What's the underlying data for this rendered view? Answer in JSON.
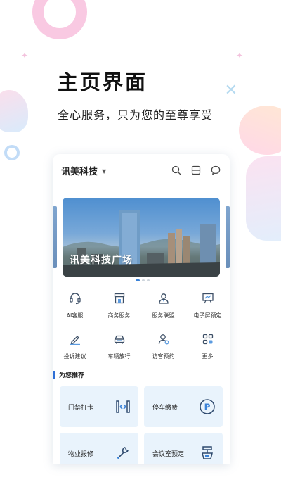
{
  "headline": {
    "title": "主页界面",
    "subtitle": "全心服务，只为您的至尊享受"
  },
  "app": {
    "company_name": "讯美科技",
    "top_icons": [
      "search-icon",
      "scan-icon",
      "message-icon"
    ],
    "banner": {
      "text": "讯美科技广场",
      "slide_count": 3,
      "active_slide": 1
    },
    "services_row1": [
      {
        "label": "AI客服",
        "icon": "headset-icon"
      },
      {
        "label": "商务服务",
        "icon": "store-icon"
      },
      {
        "label": "服务联盟",
        "icon": "person-badge-icon"
      },
      {
        "label": "电子屏预定",
        "icon": "screen-easel-icon"
      }
    ],
    "services_row2": [
      {
        "label": "投诉建议",
        "icon": "pen-edit-icon"
      },
      {
        "label": "车辆放行",
        "icon": "car-icon"
      },
      {
        "label": "访客预约",
        "icon": "visitor-icon"
      },
      {
        "label": "更多",
        "icon": "grid-more-icon"
      }
    ],
    "recommend_title": "为您推荐",
    "tiles": [
      {
        "label": "门禁打卡",
        "icon": "gate-icon"
      },
      {
        "label": "停车缴费",
        "icon": "parking-icon"
      },
      {
        "label": "物业报修",
        "icon": "wrench-icon"
      },
      {
        "label": "会议室预定",
        "icon": "meeting-icon"
      }
    ],
    "colors": {
      "accent": "#2f6fd6",
      "icon_stroke": "#3d4f66",
      "tile_bg": "#e9f3fc"
    }
  }
}
